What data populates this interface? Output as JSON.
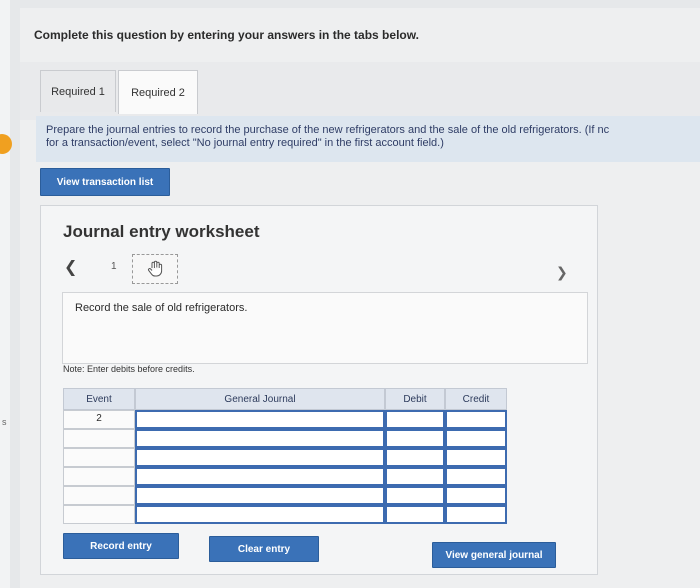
{
  "prompt": "Complete this question by entering your answers in the tabs below.",
  "tabs": [
    {
      "label": "Required 1",
      "active": false
    },
    {
      "label": "Required 2",
      "active": true
    }
  ],
  "instructions": {
    "line1": "Prepare the journal entries to record the purchase of the new refrigerators and the sale of the old refrigerators. (If nc",
    "line2": "for a transaction/event, select \"No journal entry required\" in the first account field.)"
  },
  "view_transaction_label": "View transaction list",
  "worksheet": {
    "title": "Journal entry worksheet",
    "page_number": "1",
    "record_text": "Record the sale of old refrigerators.",
    "note": "Note: Enter debits before credits.",
    "table": {
      "headers": [
        "Event",
        "General Journal",
        "Debit",
        "Credit"
      ],
      "rows": [
        {
          "event": "2"
        },
        {
          "event": ""
        },
        {
          "event": ""
        },
        {
          "event": ""
        },
        {
          "event": ""
        },
        {
          "event": ""
        }
      ]
    }
  },
  "buttons": {
    "record_entry": "Record entry",
    "clear_entry": "Clear entry",
    "view_general_journal": "View general journal"
  },
  "side_text": "s",
  "colors": {
    "button_blue": "#3a72b8",
    "input_border": "#3d6bb0",
    "instruction_bg": "#dde6ef",
    "accent_orange": "#f0a020"
  },
  "icons": {
    "prev": "chevron-left-icon",
    "next": "chevron-right-icon",
    "hand": "hand-pointer-icon"
  }
}
